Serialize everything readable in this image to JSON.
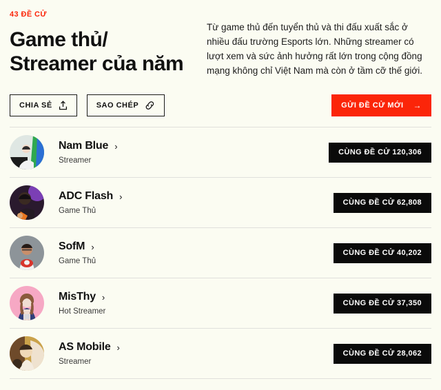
{
  "header": {
    "eyebrow": "43 ĐỀ CỬ",
    "title": "Game thủ/ Streamer của năm",
    "description": "Từ game thủ đến tuyển thủ và thi đấu xuất sắc ở nhiều đấu trường Esports lớn. Những streamer có lượt xem và sức ảnh hưởng rất lớn trong cộng đồng mạng không chỉ Việt Nam mà còn ở tầm cỡ thế giới.",
    "accent_color": "#fb2509",
    "background_color": "#fbfcf2"
  },
  "actions": {
    "share_label": "CHIA SẺ",
    "share_icon": "share-upload-icon",
    "copy_label": "SAO CHÉP",
    "copy_icon": "link-icon",
    "submit_label": "GỬI ĐỀ CỬ MỚI",
    "submit_arrow": "→"
  },
  "list": {
    "vote_prefix": "CÙNG ĐỀ CỬ",
    "chevron": "›",
    "items": [
      {
        "name": "Nam Blue",
        "role": "Streamer",
        "votes": "120,306",
        "vote_label": "CÙNG ĐỀ CỬ 120,306",
        "avatar_colors": [
          "#dfe7e3",
          "#2fa84f",
          "#2b6fd4",
          "#f3d9c8"
        ]
      },
      {
        "name": "ADC Flash",
        "role": "Game Thủ",
        "votes": "62,808",
        "vote_label": "CÙNG ĐỀ CỬ 62,808",
        "avatar_colors": [
          "#2a1a2e",
          "#7b3fb5",
          "#e8761f",
          "#d9a271"
        ]
      },
      {
        "name": "SofM",
        "role": "Game Thủ",
        "votes": "40,202",
        "vote_label": "CÙNG ĐỀ CỬ 40,202",
        "avatar_colors": [
          "#8d9499",
          "#f2f2f2",
          "#d8342c",
          "#c98f6b"
        ]
      },
      {
        "name": "MisThy",
        "role": "Hot Streamer",
        "votes": "37,350",
        "vote_label": "CÙNG ĐỀ CỬ 37,350",
        "avatar_colors": [
          "#f6a8c4",
          "#8a5a3c",
          "#2f3f7a",
          "#f0ddd2"
        ]
      },
      {
        "name": "AS Mobile",
        "role": "Streamer",
        "votes": "28,062",
        "vote_label": "CÙNG ĐỀ CỬ 28,062",
        "avatar_colors": [
          "#caa24a",
          "#f0d9b8",
          "#6e4a2a",
          "#efe2cf"
        ]
      }
    ]
  }
}
